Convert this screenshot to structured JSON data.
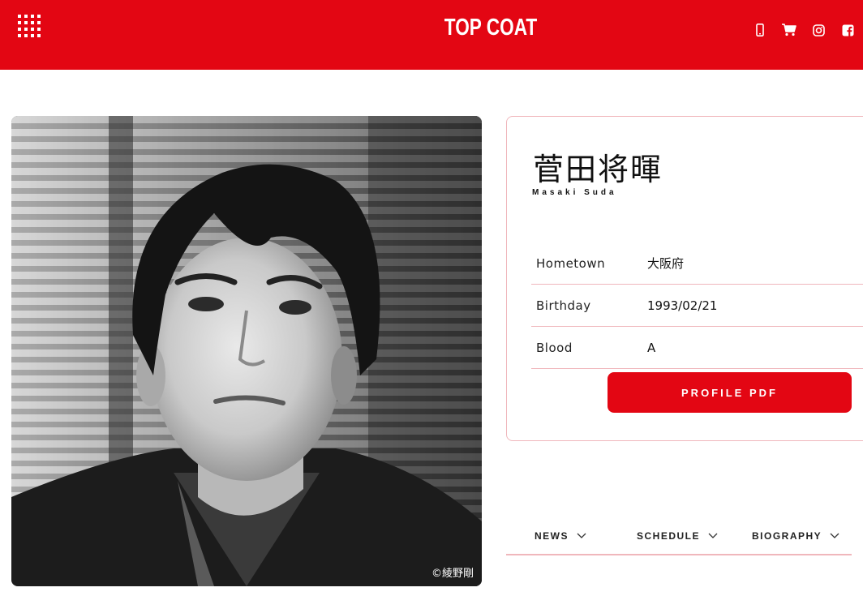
{
  "header": {
    "logo": "TOP COAT",
    "bg_color": "#e30613",
    "icons": [
      "mobile-phone-icon",
      "cart-icon",
      "instagram-icon",
      "facebook-icon"
    ]
  },
  "photo": {
    "credit": "©綾野剛"
  },
  "profile": {
    "name_jp": "菅田将暉",
    "name_en": "Masaki Suda",
    "rows": [
      {
        "label": "Hometown",
        "value": "大阪府"
      },
      {
        "label": "Birthday",
        "value": "1993/02/21"
      },
      {
        "label": "Blood",
        "value": "A"
      }
    ],
    "pdf_button": "PROFILE PDF"
  },
  "tabs": [
    {
      "label": "NEWS"
    },
    {
      "label": "SCHEDULE"
    },
    {
      "label": "BIOGRAPHY"
    }
  ]
}
